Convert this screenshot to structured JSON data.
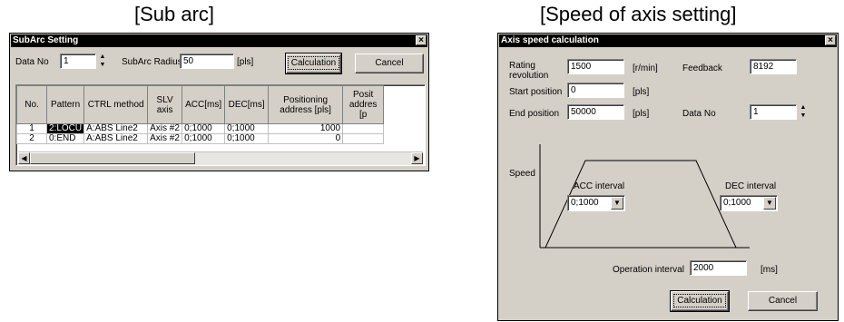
{
  "captions": {
    "left": "[Sub arc]",
    "right": "[Speed of axis setting]"
  },
  "subarc": {
    "title": "SubArc Setting",
    "close": "×",
    "data_no_label": "Data No",
    "data_no_value": "1",
    "radius_label": "SubArc Radius",
    "radius_value": "50",
    "radius_unit": "[pls]",
    "calculation_btn": "Calculation",
    "cancel_btn": "Cancel",
    "columns": [
      "No.",
      "Pattern",
      "CTRL method",
      "SLV axis",
      "ACC[ms]",
      "DEC[ms]",
      "Positioning address [pls]",
      "Posit addres [p"
    ],
    "rows": [
      [
        "1",
        "2:LOCU",
        "A:ABS Line2",
        "Axis #2",
        "0;1000",
        "0;1000",
        "1000",
        ""
      ],
      [
        "2",
        "0:END",
        "A:ABS Line2",
        "Axis #2",
        "0;1000",
        "0;1000",
        "0",
        ""
      ]
    ]
  },
  "axis": {
    "title": "Axis speed calculation",
    "close": "×",
    "rating_label_1": "Rating",
    "rating_label_2": "revolution",
    "rating_value": "1500",
    "rating_unit": "[r/min]",
    "feedback_label": "Feedback",
    "feedback_value": "8192",
    "start_label": "Start position",
    "start_value": "0",
    "start_unit": "[pls]",
    "end_label": "End position",
    "end_value": "50000",
    "end_unit": "[pls]",
    "data_no_label": "Data No",
    "data_no_value": "1",
    "speed_label": "Speed",
    "acc_label": "ACC interval",
    "acc_value": "0;1000",
    "dec_label": "DEC interval",
    "dec_value": "0;1000",
    "op_label": "Operation interval",
    "op_value": "2000",
    "op_unit": "[ms]",
    "calculation_btn": "Calculation",
    "cancel_btn": "Cancel"
  }
}
